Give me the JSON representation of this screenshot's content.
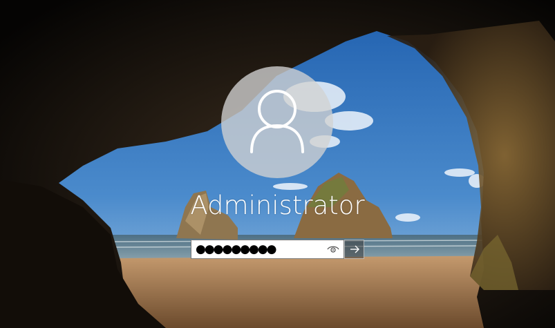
{
  "user": {
    "name": "Administrator",
    "avatar_icon": "user-avatar-icon"
  },
  "password": {
    "masked_value": "●●●●●●●●●",
    "reveal_icon": "eye-icon",
    "submit_icon": "arrow-right-icon"
  },
  "background": {
    "scene": "sea-cave-beach",
    "sky_color": "#2f6fb8",
    "sand_color": "#b5865a",
    "rock_color": "#3a2c1e"
  }
}
